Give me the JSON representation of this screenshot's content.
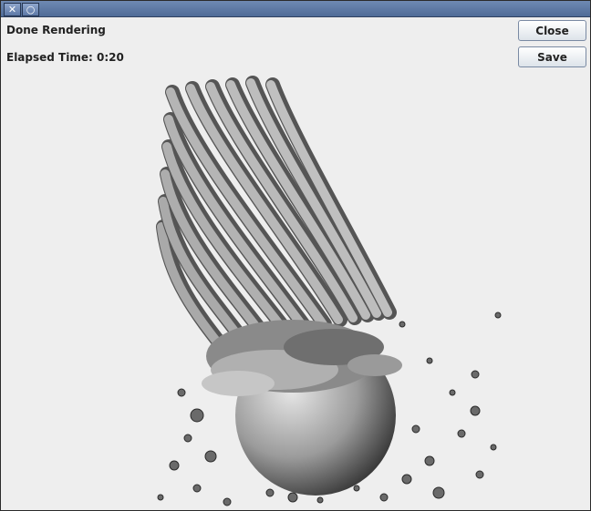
{
  "titlebar": {
    "close_icon": "close-icon",
    "restore_icon": "restore-icon"
  },
  "status": {
    "state": "Done Rendering",
    "elapsed": "Elapsed Time: 0:20"
  },
  "buttons": {
    "close_label": "Close",
    "save_label": "Save"
  }
}
